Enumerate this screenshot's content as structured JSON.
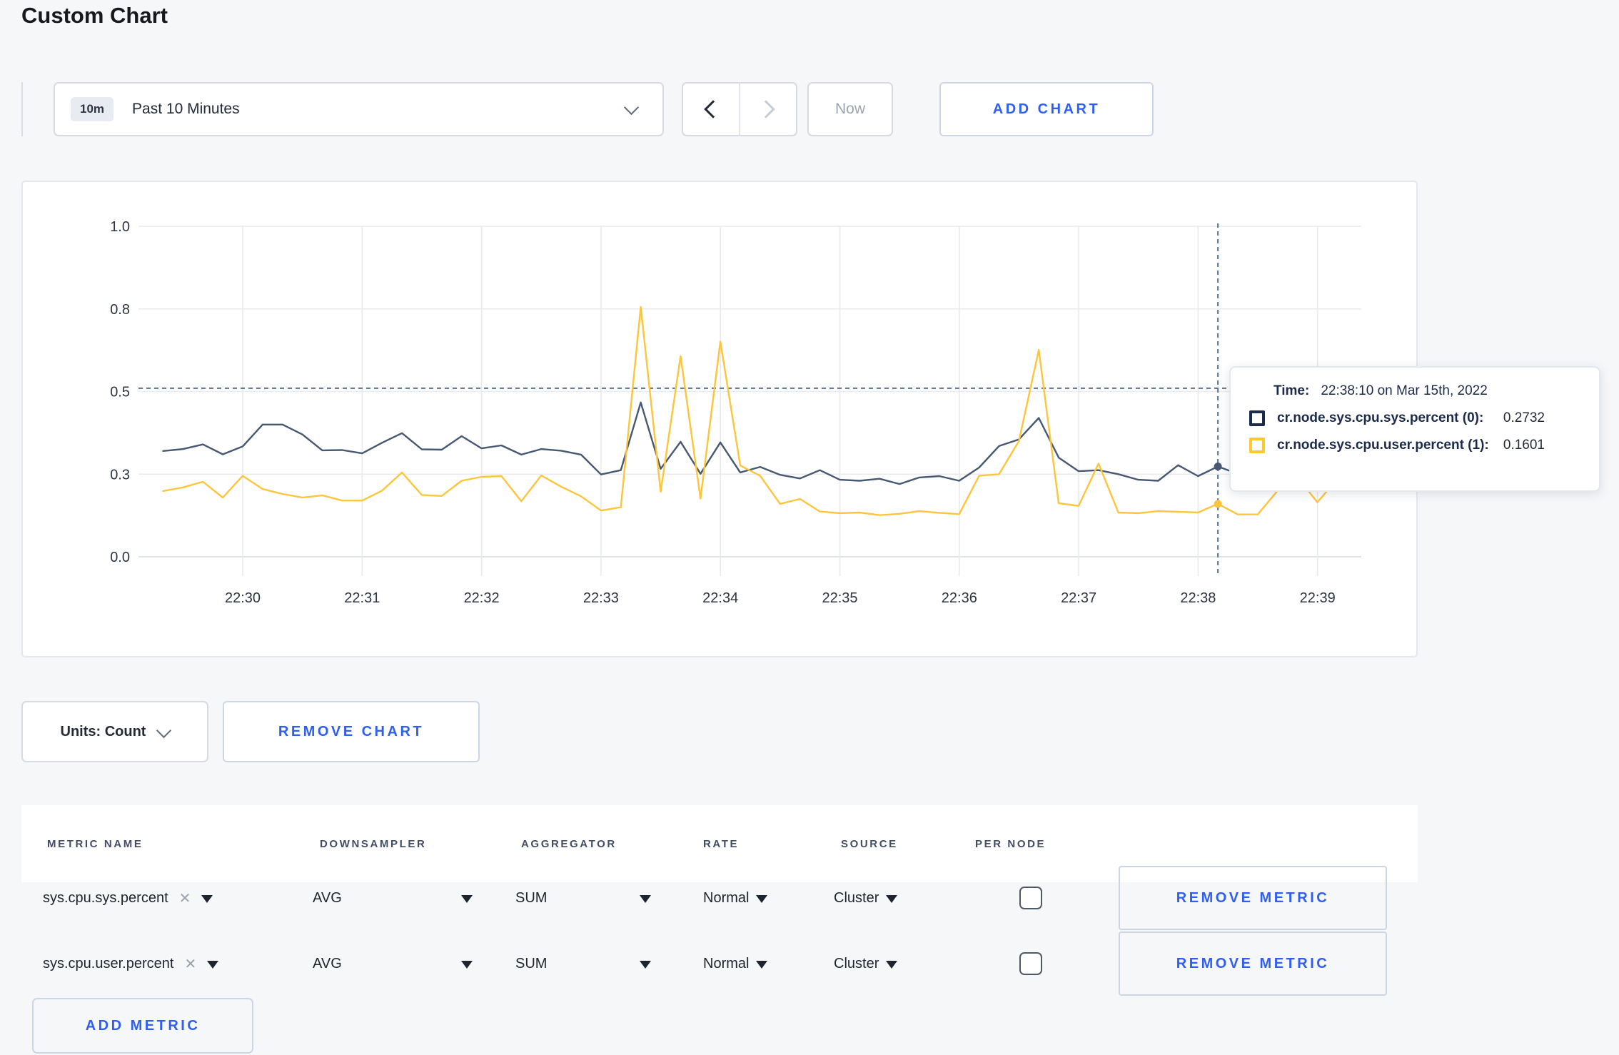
{
  "page_title": "Custom Chart",
  "colors": {
    "accent_blue": "#2f5ef3",
    "series_sys": "#475872",
    "series_user": "#fdc53b",
    "crosshair": "#54718e"
  },
  "toolbar": {
    "time_window_badge": "10m",
    "time_window_label": "Past 10 Minutes",
    "now_label": "Now",
    "add_chart_label": "ADD CHART"
  },
  "chart_controls": {
    "units_label": "Units: Count",
    "remove_chart_label": "REMOVE CHART"
  },
  "chart_data": {
    "type": "line",
    "title": "",
    "xlabel": "",
    "ylabel": "",
    "grid": true,
    "legend_position": "tooltip",
    "ylim": [
      0,
      1
    ],
    "y_ticks": [
      {
        "label": "0.0",
        "value": 0
      },
      {
        "label": "0.3",
        "value": 0.25
      },
      {
        "label": "0.5",
        "value": 0.5
      },
      {
        "label": "0.8",
        "value": 0.75
      },
      {
        "label": "1.0",
        "value": 1
      }
    ],
    "x_ticks": [
      "22:30",
      "22:31",
      "22:32",
      "22:33",
      "22:34",
      "22:35",
      "22:36",
      "22:37",
      "22:38",
      "22:39"
    ],
    "x_start": "22:29:20",
    "x_step_seconds": 10,
    "series": [
      {
        "name": "cr.node.sys.cpu.sys.percent (0)",
        "color": "#475872",
        "values": [
          0.32,
          0.326,
          0.34,
          0.31,
          0.334,
          0.4,
          0.4,
          0.37,
          0.322,
          0.323,
          0.313,
          0.345,
          0.374,
          0.325,
          0.324,
          0.365,
          0.328,
          0.337,
          0.309,
          0.326,
          0.321,
          0.309,
          0.249,
          0.262,
          0.467,
          0.266,
          0.348,
          0.251,
          0.346,
          0.255,
          0.272,
          0.248,
          0.237,
          0.262,
          0.233,
          0.23,
          0.236,
          0.22,
          0.24,
          0.244,
          0.23,
          0.27,
          0.335,
          0.355,
          0.42,
          0.3,
          0.259,
          0.262,
          0.25,
          0.233,
          0.23,
          0.277,
          0.244,
          0.2732,
          0.251,
          0.27,
          0.285,
          0.27,
          0.28,
          0.3
        ]
      },
      {
        "name": "cr.node.sys.cpu.user.percent (1)",
        "color": "#fdc53b",
        "values": [
          0.199,
          0.21,
          0.227,
          0.179,
          0.245,
          0.205,
          0.19,
          0.179,
          0.186,
          0.17,
          0.17,
          0.2,
          0.255,
          0.187,
          0.184,
          0.23,
          0.242,
          0.244,
          0.168,
          0.246,
          0.212,
          0.183,
          0.14,
          0.15,
          0.756,
          0.197,
          0.607,
          0.176,
          0.651,
          0.276,
          0.245,
          0.16,
          0.175,
          0.137,
          0.132,
          0.134,
          0.126,
          0.13,
          0.138,
          0.133,
          0.129,
          0.245,
          0.25,
          0.35,
          0.626,
          0.162,
          0.154,
          0.282,
          0.134,
          0.132,
          0.138,
          0.136,
          0.134,
          0.1601,
          0.128,
          0.128,
          0.2,
          0.24,
          0.165,
          0.235
        ]
      }
    ],
    "hover": {
      "time_label": "Time:",
      "time_value": "22:38:10 on Mar 15th, 2022",
      "point_index": 53,
      "crosshair_value": 0.51,
      "rows": [
        {
          "name": "cr.node.sys.cpu.sys.percent (0):",
          "value": "0.2732"
        },
        {
          "name": "cr.node.sys.cpu.user.percent (1):",
          "value": "0.1601"
        }
      ]
    }
  },
  "metrics_table": {
    "headers": [
      "METRIC NAME",
      "DOWNSAMPLER",
      "AGGREGATOR",
      "RATE",
      "SOURCE",
      "PER NODE"
    ],
    "rows": [
      {
        "metric": "sys.cpu.sys.percent",
        "downsampler": "AVG",
        "aggregator": "SUM",
        "rate": "Normal",
        "source": "Cluster",
        "per_node_checked": false,
        "remove_label": "REMOVE METRIC"
      },
      {
        "metric": "sys.cpu.user.percent",
        "downsampler": "AVG",
        "aggregator": "SUM",
        "rate": "Normal",
        "source": "Cluster",
        "per_node_checked": false,
        "remove_label": "REMOVE METRIC"
      }
    ],
    "add_metric_label": "ADD METRIC"
  },
  "icons": {
    "clear": "✕"
  }
}
